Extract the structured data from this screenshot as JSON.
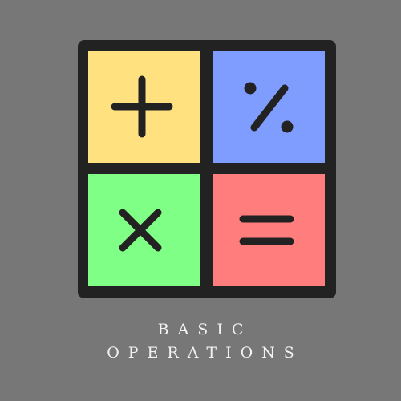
{
  "colors": {
    "background": "#777777",
    "frame": "#222222",
    "symbol": "#222222",
    "tile_plus": "#ffe17f",
    "tile_percent": "#7f9cff",
    "tile_times": "#7fff85",
    "tile_equals": "#ff7e7d",
    "caption": "#f2f2f2"
  },
  "tiles": [
    {
      "icon": "plus-icon",
      "color": "#ffe17f"
    },
    {
      "icon": "percent-icon",
      "color": "#7f9cff"
    },
    {
      "icon": "times-icon",
      "color": "#7fff85"
    },
    {
      "icon": "equals-icon",
      "color": "#ff7e7d"
    }
  ],
  "caption": {
    "line1": "BASIC",
    "line2": "OPERATIONS"
  }
}
